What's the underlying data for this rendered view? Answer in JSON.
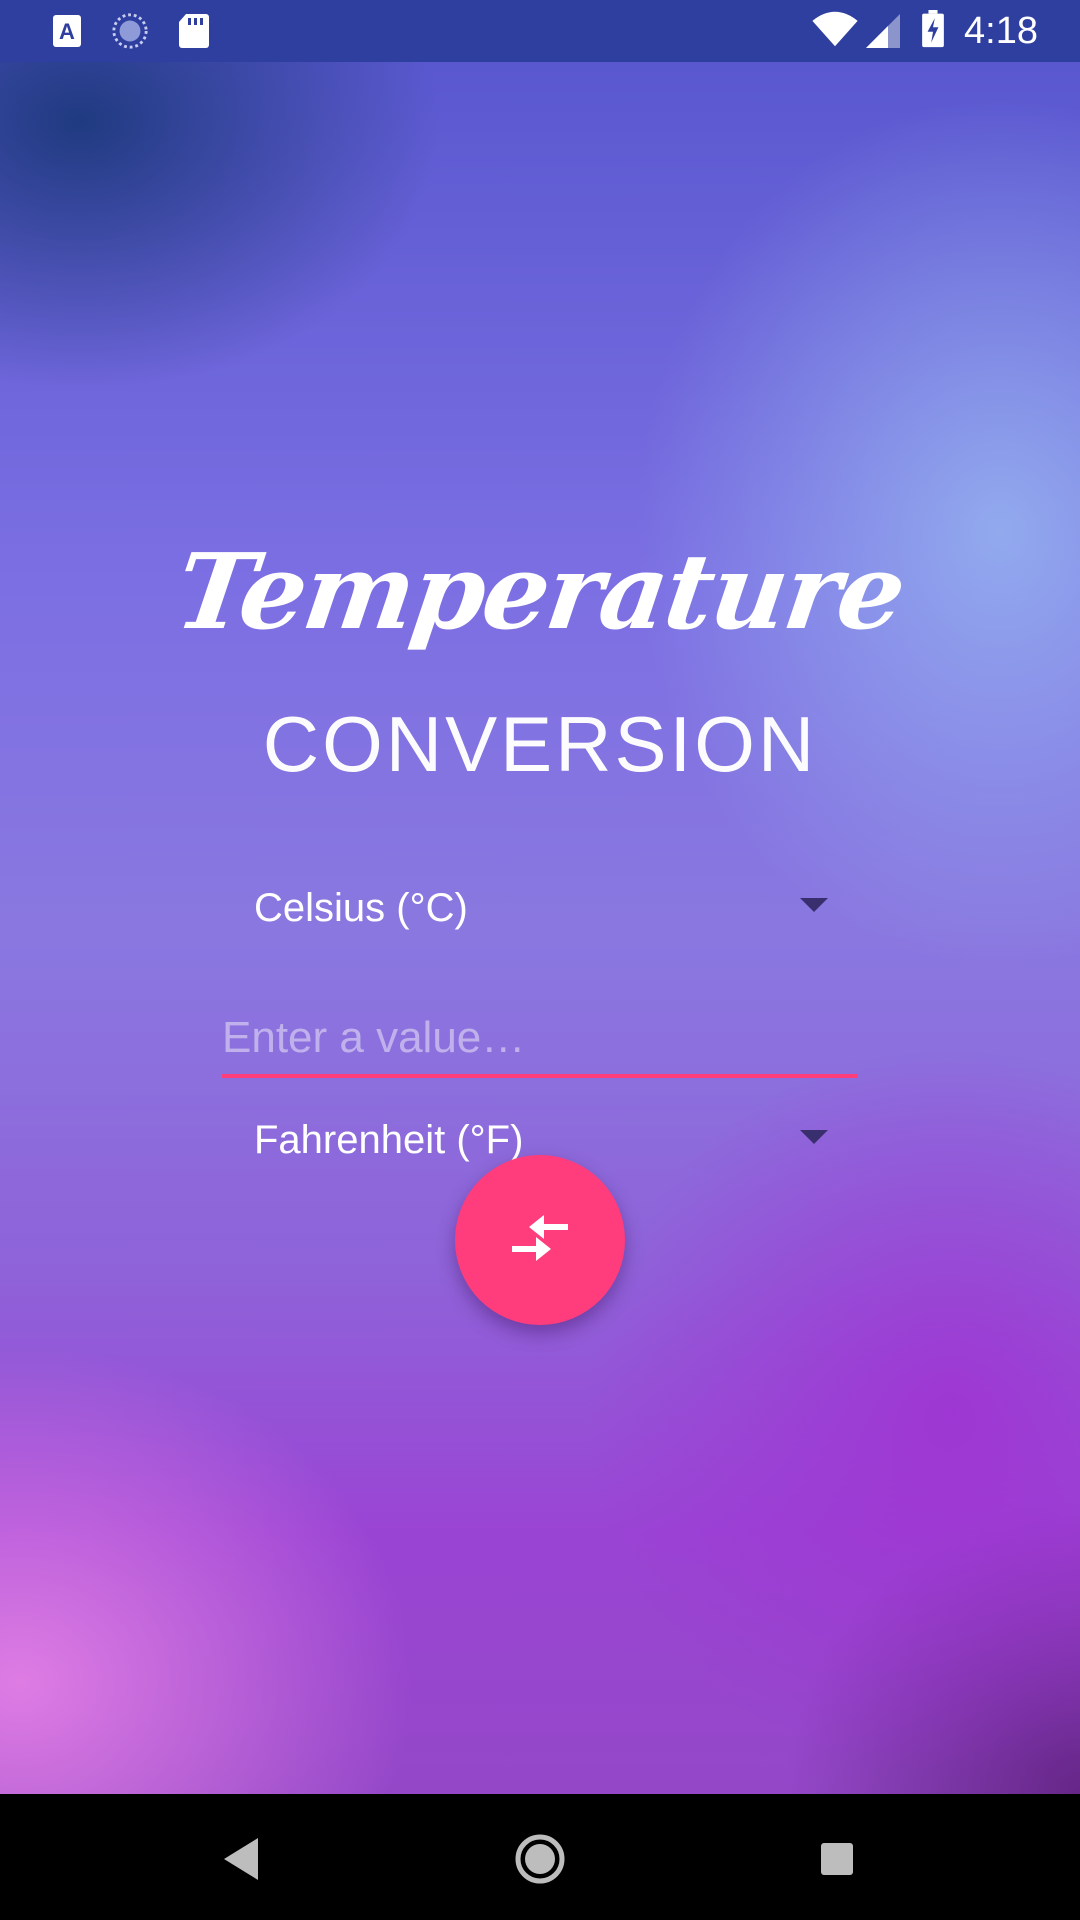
{
  "status_bar": {
    "time": "4:18",
    "left_icons": [
      "accessibility-a-icon",
      "sync-spinner-icon",
      "sd-card-icon"
    ],
    "right_icons": [
      "wifi-icon",
      "cell-signal-icon",
      "battery-charging-icon"
    ],
    "background_color": "#2f3fa0"
  },
  "header": {
    "title_script": "Temperature",
    "title_sub": "CONVERSION"
  },
  "form": {
    "from_unit": "Celsius (°C)",
    "value_placeholder": "Enter a value…",
    "value": "",
    "to_unit": "Fahrenheit (°F)",
    "convert_icon": "compare-arrows-icon",
    "accent_color": "#ff3d7d"
  },
  "nav_bar": {
    "buttons": [
      "back-icon",
      "home-icon",
      "recents-icon"
    ]
  }
}
